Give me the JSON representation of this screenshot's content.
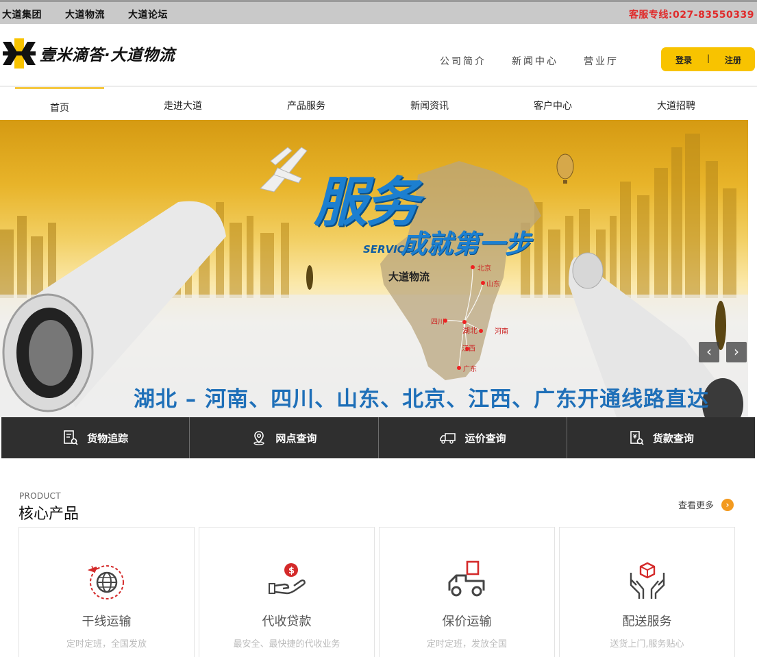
{
  "topbar": {
    "links": [
      "大道集团",
      "大道物流",
      "大道论坛"
    ],
    "hotline": "客服专线:027-83550339"
  },
  "header": {
    "logo_text": "壹米滴答·大道物流",
    "links": [
      "公司简介",
      "新闻中心",
      "营业厅"
    ],
    "login": "登录",
    "separator": "|",
    "register": "注册"
  },
  "nav": {
    "items": [
      "首页",
      "走进大道",
      "产品服务",
      "新闻资讯",
      "客户中心",
      "大道招聘"
    ],
    "active_index": 0
  },
  "banner": {
    "headline_big": "服务",
    "headline_en": "SERVICE",
    "headline_rest": "成就第一步",
    "brand": "大道物流",
    "map_labels": [
      "北京",
      "山东",
      "四川",
      "湖北",
      "河南",
      "江西",
      "广东"
    ],
    "routes": "湖北 – 河南、四川、山东、北京、江西、广东开通线路直达",
    "prev": "‹",
    "next": "›"
  },
  "quick": [
    {
      "label": "货物追踪",
      "icon": "document-search-icon"
    },
    {
      "label": "网点查询",
      "icon": "location-pin-icon"
    },
    {
      "label": "运价查询",
      "icon": "truck-icon"
    },
    {
      "label": "货款查询",
      "icon": "payment-search-icon"
    }
  ],
  "products": {
    "subtitle": "PRODUCT",
    "title": "核心产品",
    "more": "查看更多",
    "more_arrow": "›",
    "items": [
      {
        "name": "干线运输",
        "desc": "定时定班，全国发放",
        "icon": "globe-plane-icon"
      },
      {
        "name": "代收贷款",
        "desc": "最安全、最快捷的代收业务",
        "icon": "hand-coin-icon"
      },
      {
        "name": "保价运输",
        "desc": "定时定班，发放全国",
        "icon": "truck-cargo-icon"
      },
      {
        "name": "配送服务",
        "desc": "送货上门,服务贴心",
        "icon": "hands-box-icon"
      }
    ]
  },
  "colors": {
    "accent": "#f8c300",
    "hotline": "#e02a2a",
    "dark_bar": "#2f2f2f",
    "icon_red": "#d42a2a",
    "more_orange": "#f39a1f"
  }
}
